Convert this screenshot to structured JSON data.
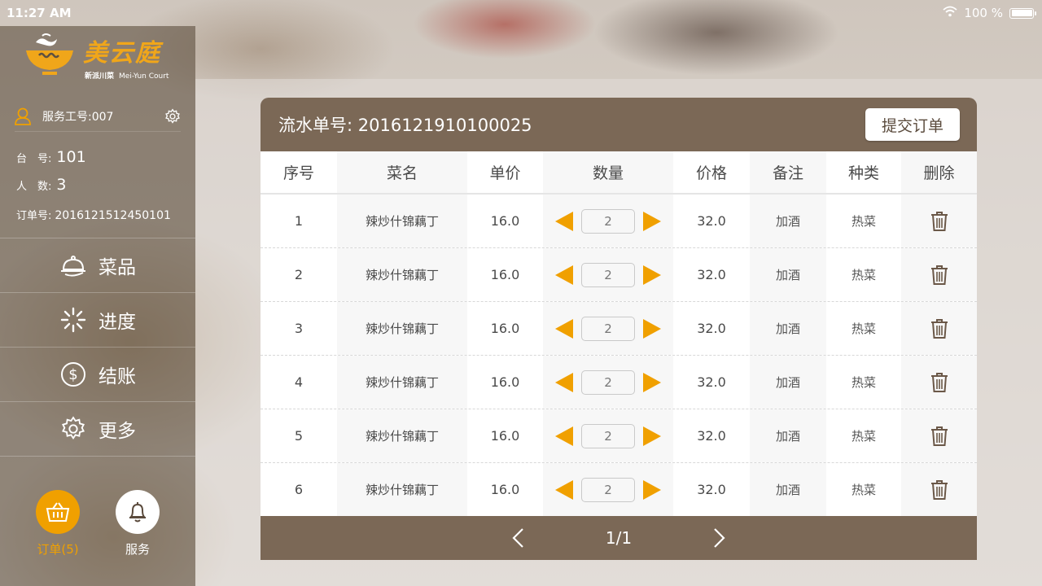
{
  "statusbar": {
    "time": "11:27 AM",
    "battery": "100 %"
  },
  "brand": {
    "name": "美云庭",
    "sub_cn": "新派川菜",
    "sub_en": "Mei-Yun Court"
  },
  "user": {
    "staff_label": "服务工号:",
    "staff_id": "007"
  },
  "info": {
    "table_label": "台　号:",
    "table_no": "101",
    "people_label": "人　数:",
    "people": "3",
    "order_label": "订单号:",
    "order_no": "2016121512450101"
  },
  "menu": [
    {
      "label": "菜品",
      "icon": "cloche-icon"
    },
    {
      "label": "进度",
      "icon": "loading-icon"
    },
    {
      "label": "结账",
      "icon": "dollar-icon"
    },
    {
      "label": "更多",
      "icon": "gear-icon"
    }
  ],
  "bottom": {
    "order_label": "订单(5)",
    "service_label": "服务"
  },
  "colors": {
    "accent": "#f0a000",
    "header_brown": "#7b6856"
  },
  "order": {
    "serial_label": "流水单号:",
    "serial_no": "2016121910100025",
    "submit_label": "提交订单",
    "columns": [
      "序号",
      "菜名",
      "单价",
      "数量",
      "价格",
      "备注",
      "种类",
      "删除"
    ],
    "rows": [
      {
        "no": "1",
        "name": "辣炒什锦藕丁",
        "price": "16.0",
        "qty": "2",
        "total": "32.0",
        "note": "加酒",
        "category": "热菜"
      },
      {
        "no": "2",
        "name": "辣炒什锦藕丁",
        "price": "16.0",
        "qty": "2",
        "total": "32.0",
        "note": "加酒",
        "category": "热菜"
      },
      {
        "no": "3",
        "name": "辣炒什锦藕丁",
        "price": "16.0",
        "qty": "2",
        "total": "32.0",
        "note": "加酒",
        "category": "热菜"
      },
      {
        "no": "4",
        "name": "辣炒什锦藕丁",
        "price": "16.0",
        "qty": "2",
        "total": "32.0",
        "note": "加酒",
        "category": "热菜"
      },
      {
        "no": "5",
        "name": "辣炒什锦藕丁",
        "price": "16.0",
        "qty": "2",
        "total": "32.0",
        "note": "加酒",
        "category": "热菜"
      },
      {
        "no": "6",
        "name": "辣炒什锦藕丁",
        "price": "16.0",
        "qty": "2",
        "total": "32.0",
        "note": "加酒",
        "category": "热菜"
      }
    ],
    "pagination": "1/1"
  }
}
